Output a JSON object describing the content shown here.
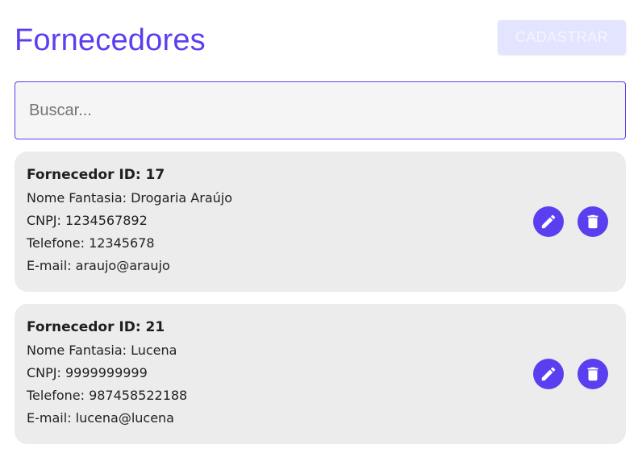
{
  "header": {
    "title": "Fornecedores",
    "register_button_label": "CADASTRAR"
  },
  "search": {
    "placeholder": "Buscar...",
    "value": ""
  },
  "suppliers": [
    {
      "heading": "Fornecedor ID: 17",
      "nome_fantasia": "Nome Fantasia: Drogaria Araújo",
      "cnpj": "CNPJ: 1234567892",
      "telefone": "Telefone: 12345678",
      "email": "E-mail: araujo@araujo"
    },
    {
      "heading": "Fornecedor ID: 21",
      "nome_fantasia": "Nome Fantasia: Lucena",
      "cnpj": "CNPJ: 9999999999",
      "telefone": "Telefone: 987458522188",
      "email": "E-mail: lucena@lucena"
    }
  ],
  "icons": {
    "edit": "pencil-icon",
    "delete": "trash-icon"
  },
  "colors": {
    "accent": "#5a3ff0",
    "button_disabled_bg": "#e3e4ff",
    "card_bg": "#ececec",
    "search_bg": "#f5f5f5"
  }
}
